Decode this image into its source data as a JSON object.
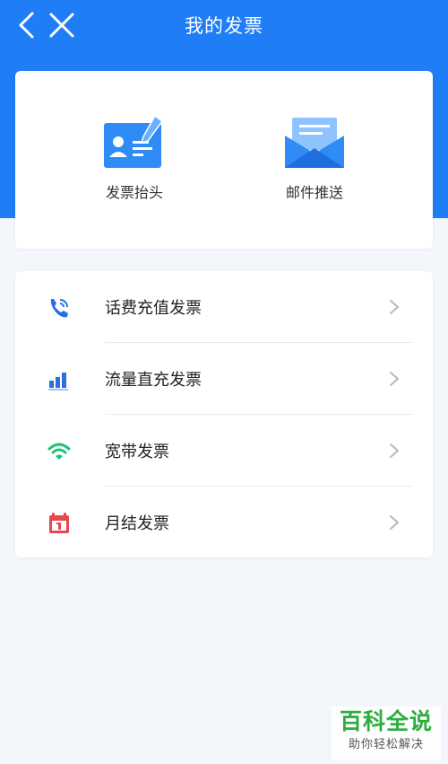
{
  "header": {
    "title": "我的发票"
  },
  "quick_actions": [
    {
      "label": "发票抬头",
      "icon": "id-card-pen-icon"
    },
    {
      "label": "邮件推送",
      "icon": "open-envelope-icon"
    }
  ],
  "invoice_types": [
    {
      "label": "话费充值发票",
      "icon": "phone-icon"
    },
    {
      "label": "流量直充发票",
      "icon": "signal-bars-icon"
    },
    {
      "label": "宽带发票",
      "icon": "wifi-icon"
    },
    {
      "label": "月结发票",
      "icon": "calendar-icon"
    }
  ],
  "watermark": {
    "title": "百科全说",
    "subtitle": "助你轻松解决"
  },
  "colors": {
    "primary": "#1f7ef6",
    "background": "#f3f6fb",
    "phone": "#2a6fe0",
    "wifi": "#1bc37a",
    "calendar": "#e5484d",
    "watermark": "#2bae3c"
  }
}
